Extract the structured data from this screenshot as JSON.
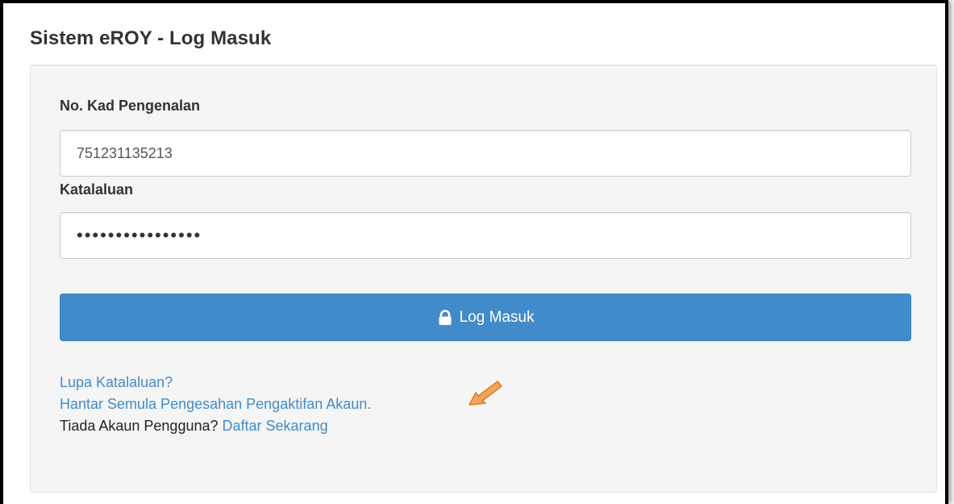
{
  "page": {
    "title": "Sistem eROY - Log Masuk"
  },
  "form": {
    "ic_label": "No. Kad Pengenalan",
    "ic_value": "751231135213",
    "password_label": "Katalaluan",
    "password_value": "••••••••••••••••",
    "login_button_label": "Log Masuk",
    "login_button_icon": "lock-icon"
  },
  "links": {
    "forgot_password": "Lupa Katalaluan?",
    "resend_activation": "Hantar Semula Pengesahan Pengaktifan Akaun.",
    "no_account_text": "Tiada Akaun Pengguna?",
    "register_now": "Daftar Sekarang"
  },
  "annotation": {
    "icon": "pointer-arrow-icon",
    "color": "#f4a460"
  },
  "colors": {
    "primary": "#428bca",
    "panel_bg": "#f5f5f5",
    "link": "#428bca"
  }
}
